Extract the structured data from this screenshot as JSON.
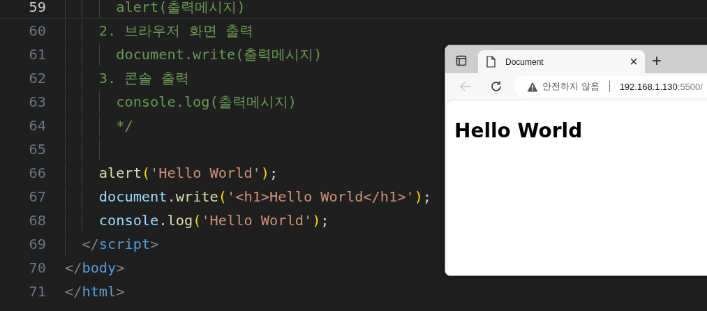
{
  "editor": {
    "lines": [
      {
        "number": "59",
        "current": true,
        "tokens": [
          {
            "kind": "guide"
          },
          {
            "kind": "guide"
          },
          {
            "kind": "guide"
          },
          {
            "kind": "comment",
            "text": "alert(출력메시지)"
          }
        ]
      },
      {
        "number": "60",
        "current": false,
        "tokens": [
          {
            "kind": "guide"
          },
          {
            "kind": "guide"
          },
          {
            "kind": "comment",
            "text": "2. 브라우저 화면 출력"
          }
        ]
      },
      {
        "number": "61",
        "current": false,
        "tokens": [
          {
            "kind": "guide"
          },
          {
            "kind": "guide"
          },
          {
            "kind": "guide"
          },
          {
            "kind": "comment",
            "text": "document.write(출력메시지)"
          }
        ]
      },
      {
        "number": "62",
        "current": false,
        "tokens": [
          {
            "kind": "guide"
          },
          {
            "kind": "guide"
          },
          {
            "kind": "comment",
            "text": "3. 콘솔 출력"
          }
        ]
      },
      {
        "number": "63",
        "current": false,
        "tokens": [
          {
            "kind": "guide"
          },
          {
            "kind": "guide"
          },
          {
            "kind": "guide"
          },
          {
            "kind": "comment",
            "text": "console.log(출력메시지)"
          }
        ]
      },
      {
        "number": "64",
        "current": false,
        "tokens": [
          {
            "kind": "guide"
          },
          {
            "kind": "guide"
          },
          {
            "kind": "guide"
          },
          {
            "kind": "comment",
            "text": "*/"
          }
        ]
      },
      {
        "number": "65",
        "current": false,
        "tokens": [
          {
            "kind": "guide"
          },
          {
            "kind": "guide"
          },
          {
            "kind": "guide"
          }
        ]
      },
      {
        "number": "66",
        "current": false,
        "tokens": [
          {
            "kind": "guide"
          },
          {
            "kind": "guide"
          },
          {
            "kind": "func",
            "text": "alert"
          },
          {
            "kind": "bracket",
            "text": "("
          },
          {
            "kind": "string",
            "text": "'Hello World'"
          },
          {
            "kind": "bracket",
            "text": ")"
          },
          {
            "kind": "punct",
            "text": ";"
          }
        ]
      },
      {
        "number": "67",
        "current": false,
        "tokens": [
          {
            "kind": "guide"
          },
          {
            "kind": "guide"
          },
          {
            "kind": "var",
            "text": "document"
          },
          {
            "kind": "punct",
            "text": "."
          },
          {
            "kind": "func",
            "text": "write"
          },
          {
            "kind": "bracket",
            "text": "("
          },
          {
            "kind": "string",
            "text": "'<h1>Hello World</h1>'"
          },
          {
            "kind": "bracket",
            "text": ")"
          },
          {
            "kind": "punct",
            "text": ";"
          }
        ]
      },
      {
        "number": "68",
        "current": false,
        "tokens": [
          {
            "kind": "guide"
          },
          {
            "kind": "guide"
          },
          {
            "kind": "var",
            "text": "console"
          },
          {
            "kind": "punct",
            "text": "."
          },
          {
            "kind": "func",
            "text": "log"
          },
          {
            "kind": "bracket",
            "text": "("
          },
          {
            "kind": "string",
            "text": "'Hello World'"
          },
          {
            "kind": "bracket",
            "text": ")"
          },
          {
            "kind": "punct",
            "text": ";"
          }
        ]
      },
      {
        "number": "69",
        "current": false,
        "tokens": [
          {
            "kind": "guide"
          },
          {
            "kind": "tagpunct",
            "text": "</"
          },
          {
            "kind": "tag",
            "text": "script"
          },
          {
            "kind": "tagpunct",
            "text": ">"
          }
        ]
      },
      {
        "number": "70",
        "current": false,
        "tokens": [
          {
            "kind": "tagpunct",
            "text": "</"
          },
          {
            "kind": "tag",
            "text": "body"
          },
          {
            "kind": "tagpunct",
            "text": ">"
          }
        ]
      },
      {
        "number": "71",
        "current": false,
        "tokens": [
          {
            "kind": "tagpunct",
            "text": "</"
          },
          {
            "kind": "tag",
            "text": "html"
          },
          {
            "kind": "tagpunct",
            "text": ">"
          }
        ]
      }
    ]
  },
  "browser": {
    "tabs": [
      {
        "title": "Document",
        "close": "×",
        "selected": true
      }
    ],
    "new_tab": "+",
    "nav": {
      "back": {
        "disabled": true
      }
    },
    "address": {
      "security": "안전하지 않음",
      "host": "192.168.1.130",
      "port": ":5500/"
    },
    "page": {
      "heading": "Hello World"
    }
  }
}
